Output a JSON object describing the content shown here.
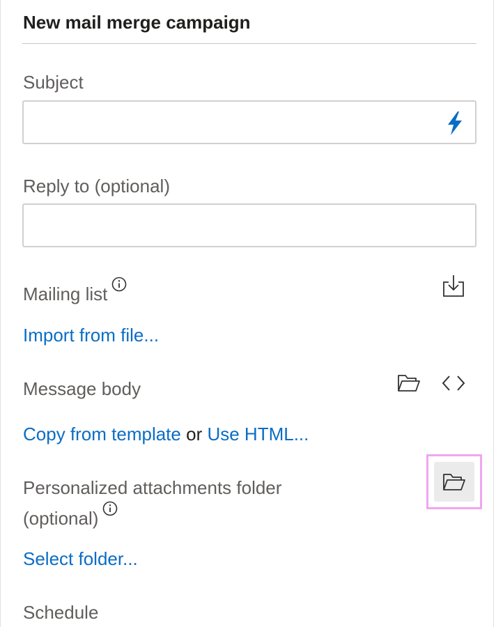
{
  "panel": {
    "title": "New mail merge campaign"
  },
  "subject": {
    "label": "Subject",
    "value": "",
    "placeholder": "",
    "action_icon": "lightning-bolt-icon",
    "action_color": "#0a6dc4"
  },
  "reply_to": {
    "label": "Reply to (optional)",
    "value": "",
    "placeholder": ""
  },
  "mailing_list": {
    "label": "Mailing list",
    "info_icon": "info-icon",
    "action_icon": "download-icon",
    "import_link": "Import from file..."
  },
  "message_body": {
    "label": "Message body",
    "open_icon": "folder-open-icon",
    "html_icon": "code-icon",
    "template_link": "Copy from template",
    "or_text": "or",
    "html_link": "Use HTML..."
  },
  "attachments": {
    "label_line1": "Personalized attachments folder",
    "label_line2": "(optional)",
    "info_icon": "info-icon",
    "folder_icon": "folder-open-icon",
    "select_link": "Select folder..."
  },
  "schedule": {
    "label": "Schedule"
  },
  "colors": {
    "link": "#0a6dc4",
    "label": "#605e5c",
    "title": "#201f1e",
    "highlight": "#f0a6f0"
  }
}
